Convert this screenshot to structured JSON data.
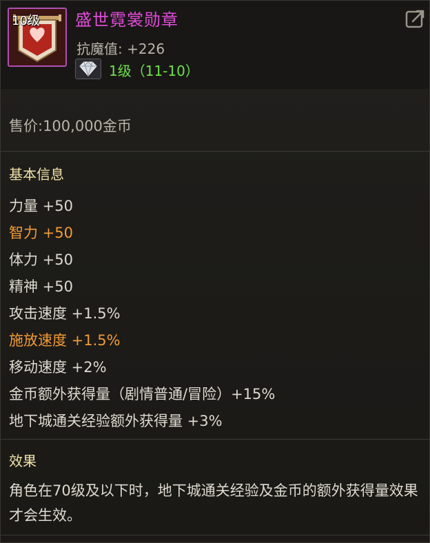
{
  "item": {
    "level_badge": "10级",
    "name": "盛世霓裳勋章",
    "resist_label": "抗魔值:",
    "resist_value": "+226",
    "upgrade_text": "1级（11-10）",
    "icon": "crest-banner-icon",
    "gem_icon": "diamond-gem-icon"
  },
  "toolbar": {
    "export_icon": "share-export-icon"
  },
  "price": {
    "text": "售价:100,000金币"
  },
  "basic_info": {
    "title": "基本信息",
    "stats": [
      {
        "text": "力量 +50",
        "highlight": false
      },
      {
        "text": "智力 +50",
        "highlight": true
      },
      {
        "text": "体力 +50",
        "highlight": false
      },
      {
        "text": "精神 +50",
        "highlight": false
      },
      {
        "text": "攻击速度 +1.5%",
        "highlight": false
      },
      {
        "text": "施放速度 +1.5%",
        "highlight": true
      },
      {
        "text": "移动速度 +2%",
        "highlight": false
      },
      {
        "text": "金币额外获得量（剧情普通/冒险）+15%",
        "highlight": false
      },
      {
        "text": "地下城通关经验额外获得量 +3%",
        "highlight": false
      }
    ]
  },
  "effect": {
    "title": "效果",
    "text": "角色在70级及以下时，地下城通关经验及金币的额外获得量效果才会生效。"
  },
  "colors": {
    "name": "#e14ad9",
    "upgrade": "#6fe14c",
    "highlight": "#f39a35",
    "section_title": "#f0e2a8",
    "text": "#dedad0",
    "muted": "#b9b4a8"
  }
}
